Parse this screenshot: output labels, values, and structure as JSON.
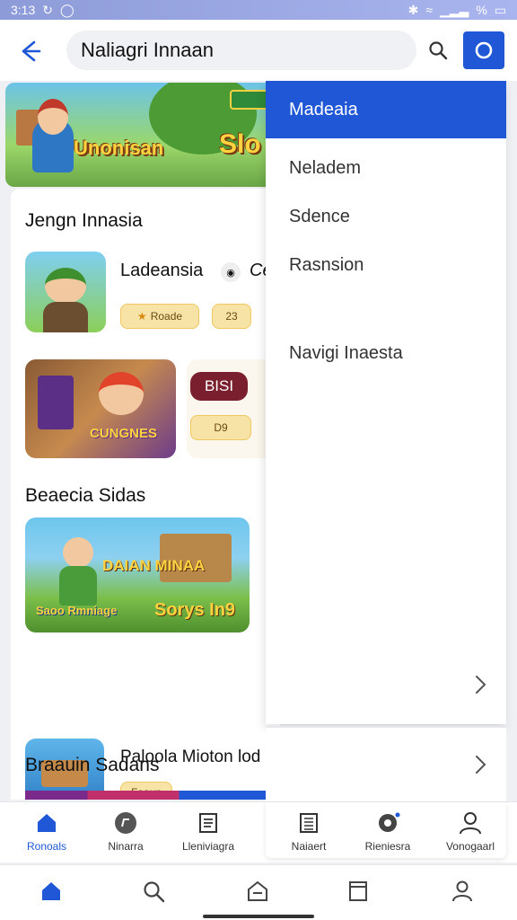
{
  "status": {
    "time": "3:13",
    "battery": "%"
  },
  "header": {
    "search_text": "Naliagri Innaan"
  },
  "sections": {
    "first_title": "Jengn Innasia",
    "second_title": "Beaecia Sidas",
    "third_title": "Braauin Sadans"
  },
  "banner": {
    "text1": "Unonisan",
    "text2": "Slo"
  },
  "apps": [
    {
      "name": "Ladeansia",
      "chip1": "Roade",
      "chip2": "23",
      "side_text": "Ce"
    },
    {
      "thumb_text": "CUNGNES",
      "label_badge": "BISI",
      "chip": "D9"
    },
    {
      "thumb_text": "DAIAN MINAA",
      "bottom_text_left": "Saoo Rmniage",
      "bottom_text_right": "Sorys In9"
    },
    {
      "name": "Paloola Mioton lod",
      "chip": "Faaun"
    }
  ],
  "menu": {
    "selected": "Madeaia",
    "items": [
      "Neladem",
      "Sdence",
      "Rasnsion",
      "Navigi Inaesta"
    ]
  },
  "inner_nav": {
    "items": [
      "Ronoals",
      "Ninarra",
      "Lleniviagra",
      "Naiaert",
      "Rieniesra",
      "Vonogaarl"
    ],
    "active_index": 0
  },
  "colors": {
    "accent": "#1f57d6"
  }
}
